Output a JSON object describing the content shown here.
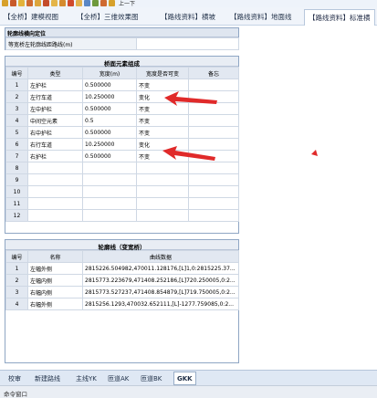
{
  "toolbar": {
    "label": "上一下"
  },
  "tabs": [
    {
      "label": "【全桥】建模视图",
      "active": false
    },
    {
      "label": "【全桥】三维效果图",
      "active": false
    },
    {
      "label": "【路线资料】横坡",
      "active": false
    },
    {
      "label": "【路线资料】地面线",
      "active": false
    },
    {
      "label": "【路线资料】标准横",
      "active": true
    }
  ],
  "positioning": {
    "title": "轮廓线横向定位",
    "row_label": "等宽桥左轮廓线距路线(m)",
    "row_value": ""
  },
  "bridge_elements": {
    "title": "桥面元素组成",
    "headers": [
      "编号",
      "类型",
      "宽度(m)",
      "宽度是否可变",
      "备忘"
    ],
    "rows": [
      [
        "1",
        "左护栏",
        "0.500000",
        "不变",
        ""
      ],
      [
        "2",
        "左行车道",
        "10.250000",
        "变化",
        ""
      ],
      [
        "3",
        "左中护栏",
        "0.500000",
        "不变",
        ""
      ],
      [
        "4",
        "中间空元素",
        "0.5",
        "不变",
        ""
      ],
      [
        "5",
        "右中护栏",
        "0.500000",
        "不变",
        ""
      ],
      [
        "6",
        "右行车道",
        "10.250000",
        "变化",
        ""
      ],
      [
        "7",
        "右护栏",
        "0.500000",
        "不变",
        ""
      ],
      [
        "8",
        "",
        "",
        "",
        ""
      ],
      [
        "9",
        "",
        "",
        "",
        ""
      ],
      [
        "10",
        "",
        "",
        "",
        ""
      ],
      [
        "11",
        "",
        "",
        "",
        ""
      ],
      [
        "12",
        "",
        "",
        "",
        ""
      ]
    ]
  },
  "contour": {
    "title": "轮廓线（变宽桥）",
    "headers": [
      "编号",
      "名称",
      "曲线数据"
    ],
    "rows": [
      [
        "1",
        "左幅外侧",
        "2815226.504982,470011.128176,[L]1,0:2815225.37..."
      ],
      [
        "2",
        "左幅内侧",
        "2815773.223679,471408.252186,[L]720.250005,0:2..."
      ],
      [
        "3",
        "右幅内侧",
        "2815773.527237,471408.854879,[L]719.750005,0:2..."
      ],
      [
        "4",
        "右幅外侧",
        "2815256.1293,470032.652111,[L]-1277.759085,0:2..."
      ]
    ]
  },
  "bottom_tabs": [
    {
      "label": "校审",
      "active": false
    },
    {
      "label": "新建路线",
      "active": false
    },
    {
      "label": "主线YK",
      "active": false
    },
    {
      "label": "匝道AK",
      "active": false
    },
    {
      "label": "匝道BK",
      "active": false
    },
    {
      "label": "GKK",
      "active": true
    }
  ],
  "status": {
    "label": "命令窗口"
  },
  "colors": {
    "arrow": "#e02a2a",
    "accent": "#dfe6f0"
  }
}
